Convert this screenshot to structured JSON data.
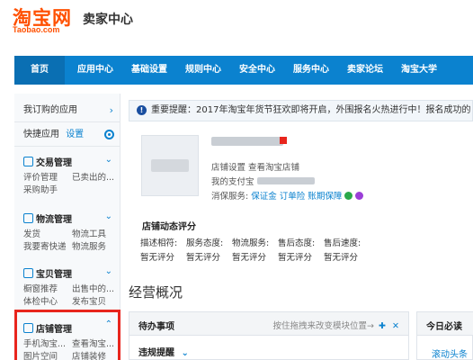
{
  "header": {
    "logo_main": "淘宝网",
    "logo_sub": "Taobao.com",
    "title": "卖家中心"
  },
  "nav": {
    "items": [
      "首页",
      "应用中心",
      "基础设置",
      "规则中心",
      "安全中心",
      "服务中心",
      "卖家论坛",
      "淘宝大学"
    ],
    "active_index": 0
  },
  "sidebar": {
    "my_apps": "我订购的应用",
    "quick_apps": "快捷应用",
    "quick_settings": "设置",
    "sections": [
      {
        "title": "交易管理",
        "icon": "order-icon",
        "links": [
          "评价管理",
          "已卖出的...",
          "采购助手"
        ]
      },
      {
        "title": "物流管理",
        "icon": "truck-icon",
        "links": [
          "发货",
          "物流工具",
          "我要寄快递",
          "物流服务"
        ]
      },
      {
        "title": "宝贝管理",
        "icon": "trophy-icon",
        "links": [
          "橱窗推荐",
          "出售中的...",
          "体检中心",
          "发布宝贝"
        ]
      },
      {
        "title": "店铺管理",
        "icon": "store-icon",
        "links": [
          "手机淘宝...",
          "查看淘宝...",
          "图片空间",
          "店铺装修"
        ]
      }
    ]
  },
  "notice": {
    "text": "重要提醒：2017年淘宝年货节狂欢即将开启，外围报名火热进行中！报名成功的"
  },
  "shop": {
    "line1": "店铺设置 查看淘宝店铺",
    "line2": "我的支付宝",
    "services_label": "消保服务:",
    "services": [
      "保证金",
      "订单险",
      "账期保障"
    ]
  },
  "rating": {
    "title": "店铺动态评分",
    "labels": [
      "描述相符:",
      "服务态度:",
      "物流服务:",
      "售后态度:",
      "售后速度:"
    ],
    "values": [
      "暂无评分",
      "暂无评分",
      "暂无评分",
      "暂无评分",
      "暂无评分"
    ]
  },
  "overview": {
    "title": "经营概况"
  },
  "todo": {
    "title": "待办事项",
    "hint": "按住拖拽来改变模块位置→",
    "sub": "违规提醒"
  },
  "today": {
    "title": "今日必读",
    "sub": "滚动头条"
  },
  "colors": {
    "brand_orange": "#ff5000",
    "nav_blue": "#0b82cf",
    "highlight_red": "#e8251d"
  }
}
